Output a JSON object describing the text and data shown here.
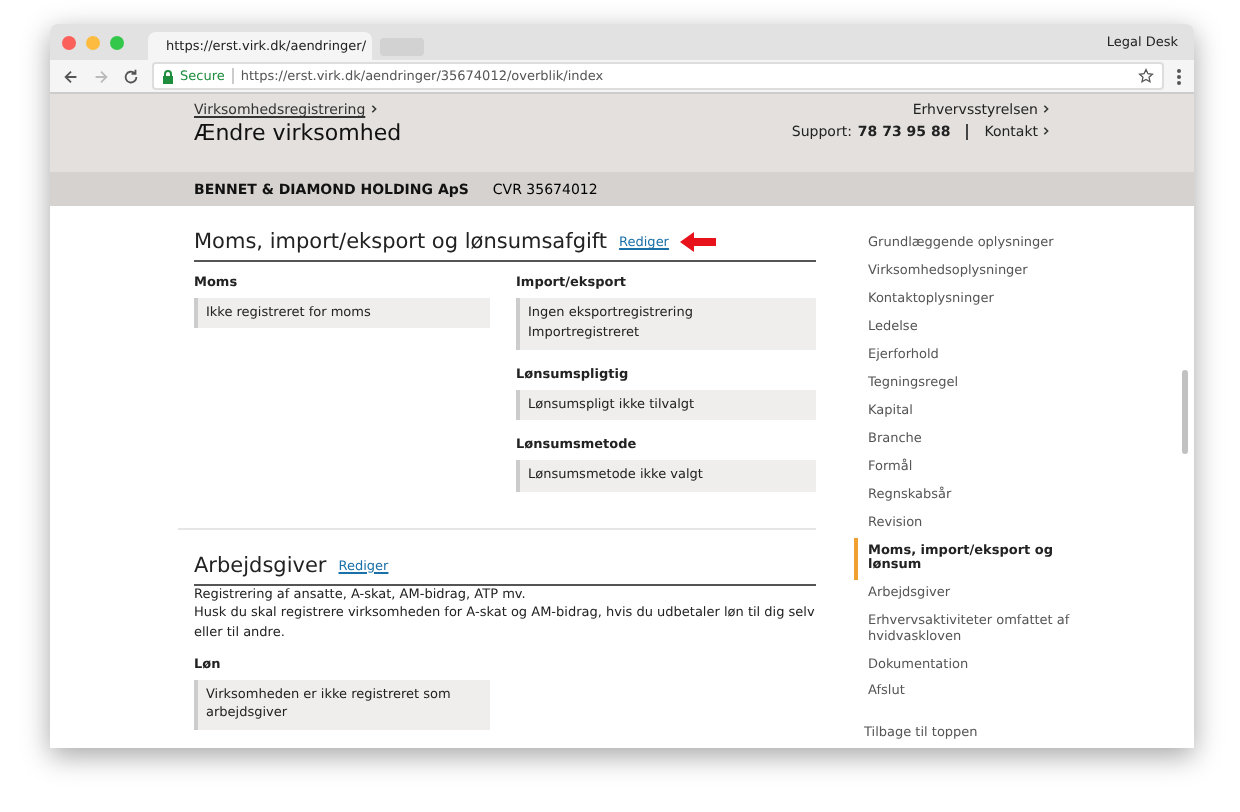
{
  "browser": {
    "tab_title": "https://erst.virk.dk/aendringer/",
    "profile": "Legal Desk",
    "secure_label": "Secure",
    "url": "https://erst.virk.dk/aendringer/35674012/overblik/index"
  },
  "header": {
    "breadcrumb": "Virksomhedsregistrering",
    "title": "Ændre virksomhed",
    "agency": "Erhvervsstyrelsen",
    "support_label": "Support:",
    "support_number": "78 73 95 88",
    "contact": "Kontakt"
  },
  "company": {
    "name": "BENNET & DIAMOND HOLDING ApS",
    "cvr": "CVR 35674012"
  },
  "sections": [
    {
      "title": "Moms, import/eksport og lønsumsafgift",
      "edit_link": "Rediger",
      "highlighted": true,
      "columns": [
        [
          {
            "label": "Moms",
            "values": [
              "Ikke registreret for moms"
            ]
          }
        ],
        [
          {
            "label": "Import/eksport",
            "values": [
              "Ingen eksportregistrering",
              "Importregistreret"
            ]
          },
          {
            "label": "Lønsumspligtig",
            "values": [
              "Lønsumspligt ikke tilvalgt"
            ]
          },
          {
            "label": "Lønsumsmetode",
            "values": [
              "Lønsumsmetode ikke valgt"
            ]
          }
        ]
      ]
    },
    {
      "title": "Arbejdsgiver",
      "edit_link": "Rediger",
      "highlighted": false,
      "description": [
        "Registrering af ansatte, A-skat, AM-bidrag, ATP mv.",
        "Husk du skal registrere virksomheden for A-skat og AM-bidrag, hvis du udbetaler løn til dig selv eller til andre."
      ],
      "columns": [
        [
          {
            "label": "Løn",
            "values": [
              "Virksomheden er ikke registreret som arbejdsgiver"
            ]
          }
        ],
        []
      ]
    }
  ],
  "sidebar": {
    "items": [
      {
        "label": "Grundlæggende oplysninger",
        "selected": false
      },
      {
        "label": "Virksomhedsoplysninger",
        "selected": false
      },
      {
        "label": "Kontaktoplysninger",
        "selected": false
      },
      {
        "label": "Ledelse",
        "selected": false
      },
      {
        "label": "Ejerforhold",
        "selected": false
      },
      {
        "label": "Tegningsregel",
        "selected": false
      },
      {
        "label": "Kapital",
        "selected": false
      },
      {
        "label": "Branche",
        "selected": false
      },
      {
        "label": "Formål",
        "selected": false
      },
      {
        "label": "Regnskabsår",
        "selected": false
      },
      {
        "label": "Revision",
        "selected": false
      },
      {
        "label": "Moms, import/eksport og lønsum",
        "selected": true
      },
      {
        "label": "Arbejdsgiver",
        "selected": false
      },
      {
        "label": "Erhvervsaktiviteter omfattet af hvidvaskloven",
        "selected": false
      },
      {
        "label": "Dokumentation",
        "selected": false
      },
      {
        "label": "Afslut",
        "selected": false
      }
    ],
    "back_to_top": "Tilbage til toppen"
  }
}
